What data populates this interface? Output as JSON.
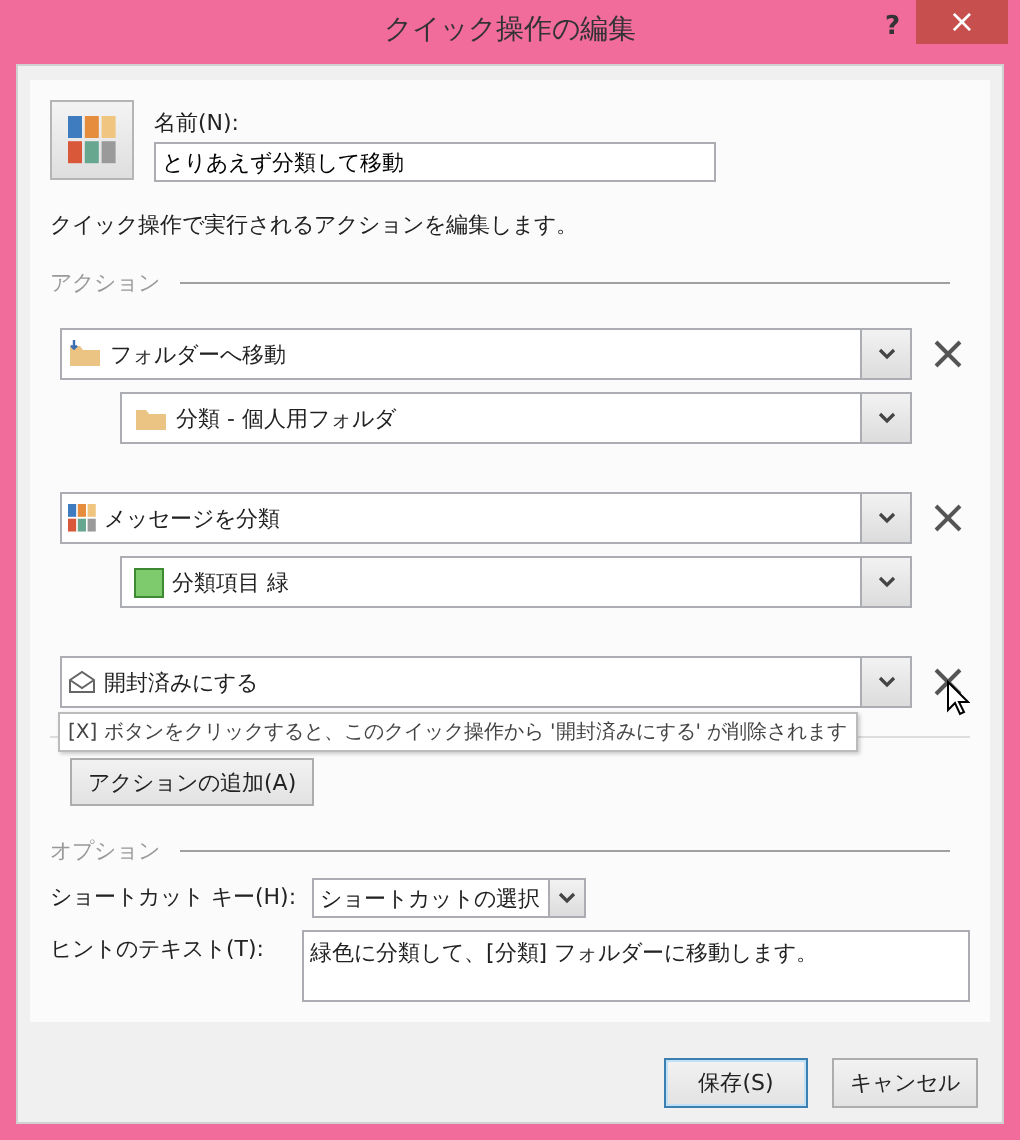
{
  "window": {
    "title": "クイック操作の編集",
    "help": "?",
    "close": "×"
  },
  "name": {
    "label": "名前(N):",
    "value": "とりあえず分類して移動"
  },
  "description": "クイック操作で実行されるアクションを編集します。",
  "actions_group": {
    "label": "アクション"
  },
  "actions": [
    {
      "kind": "move",
      "label": "フォルダーへ移動",
      "option": {
        "kind": "folder",
        "label": "分類 - 個人用フォルダ"
      }
    },
    {
      "kind": "categorize",
      "label": "メッセージを分類",
      "option": {
        "kind": "color",
        "color": "#7dcb6d",
        "label": "分類項目 緑"
      }
    },
    {
      "kind": "read",
      "label": "開封済みにする"
    }
  ],
  "tooltip": "[X] ボタンをクリックすると、このクイック操作から '開封済みにする' が削除されます",
  "add_action": "アクションの追加(A)",
  "options_group": {
    "label": "オプション"
  },
  "shortcut": {
    "label": "ショートカット キー(H):",
    "value": "ショートカットの選択"
  },
  "hint": {
    "label": "ヒントのテキスト(T):",
    "value": "緑色に分類して、[分類] フォルダーに移動します。"
  },
  "buttons": [
    {
      "label": "保存(S)",
      "default": true
    },
    {
      "label": "キャンセル",
      "default": false
    }
  ]
}
